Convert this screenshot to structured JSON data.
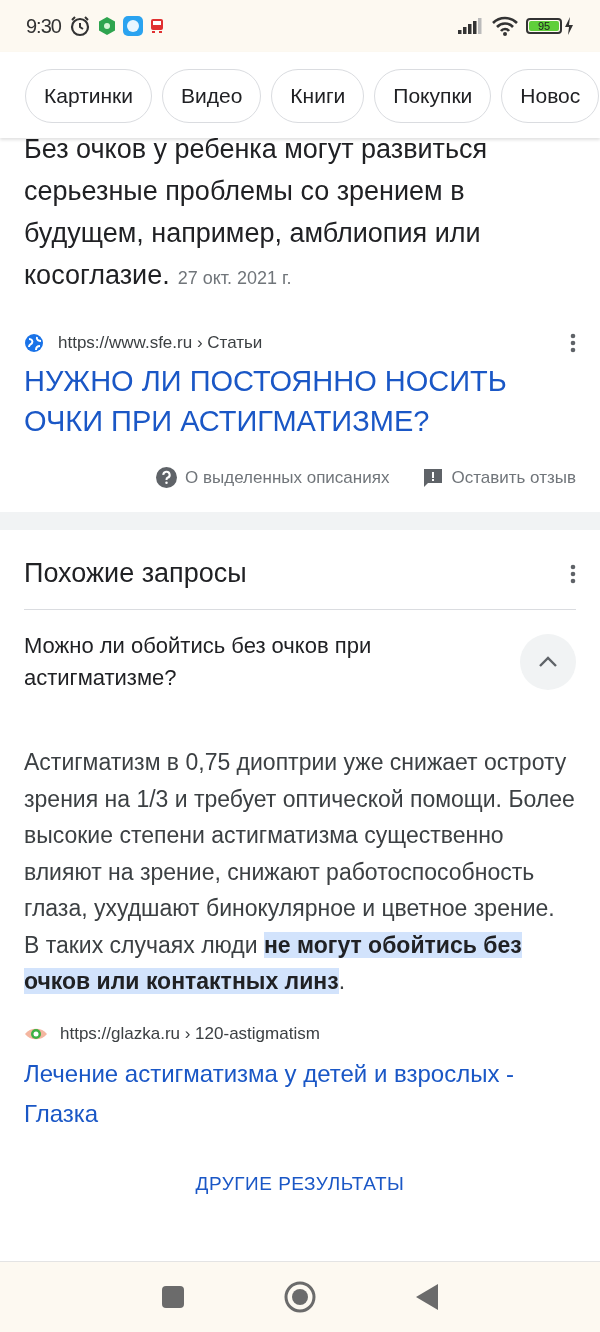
{
  "status_bar": {
    "time": "9:30",
    "battery": "95"
  },
  "chips": [
    {
      "label": "Картинки"
    },
    {
      "label": "Видео"
    },
    {
      "label": "Книги"
    },
    {
      "label": "Покупки"
    },
    {
      "label": "Новос"
    }
  ],
  "snippet": {
    "text": "Без очков у ребенка могут развиться серьезные проблемы со зрением в будущем, например, амблиопия или косоглазие.",
    "date": "27 окт. 2021 г.",
    "url": "https://www.sfe.ru › Статьи",
    "title": "НУЖНО ЛИ ПОСТОЯННО НОСИТЬ ОЧКИ ПРИ АСТИГМАТИЗМЕ?",
    "about": "О выделенных описаниях",
    "feedback": "Оставить отзыв"
  },
  "related": {
    "title": "Похожие запросы",
    "question": {
      "text": "Можно ли обойтись без очков при астигматизме?",
      "expanded": true
    },
    "answer": "Астигматизм в 0,75 диоптрии уже снижает остроту зрения на 1/3 и требует оптической помощи. Более высокие степени астигматизма существенно влияют на зрение, снижают работоспособность глаза, ухудшают бинокулярное и цветное зрение. В таких случаях люди **не могут обойтись без очков или контактных линз**.",
    "url": "https://glazka.ru › 120-astigmatism",
    "link": "Лечение астигматизма у детей и взрослых - Глазка",
    "more": "ДРУГИЕ РЕЗУЛЬТАТЫ"
  }
}
